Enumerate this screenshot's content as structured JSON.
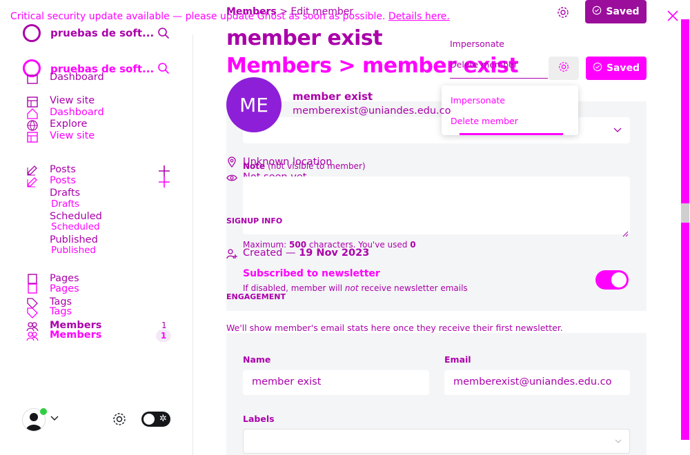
{
  "banner": {
    "text": "Critical security update available — please update Ghost as soon as possible.",
    "link": "Details here."
  },
  "sidebar": {
    "site_name": "pruebas de soft...",
    "site_name_2": "pruebas de soft...",
    "nav_a": [
      "Dashboard",
      "View site"
    ],
    "nav_b": [
      "Dashboard",
      "Explore",
      "View site"
    ],
    "posts": "Posts",
    "posts_2": "Posts",
    "drafts": "Drafts",
    "drafts_2": "Drafts",
    "scheduled": "Scheduled",
    "scheduled_2": "Scheduled",
    "published": "Published",
    "published_2": "Published",
    "pages": "Pages",
    "pages_2": "Pages",
    "tags": "Tags",
    "tags_2": "Tags",
    "members": "Members",
    "members_2": "Members",
    "members_count": "1",
    "members_count_2": "1"
  },
  "header": {
    "breadcrumb_parent": "Members",
    "breadcrumb_sep": ">",
    "breadcrumb_current": "Edit member",
    "title": "member exist",
    "title_2": "Members > member exist",
    "saved": "Saved",
    "saved_2": "Saved"
  },
  "actions_menu": {
    "impersonate": "Impersonate",
    "delete": "Delete member",
    "impersonate_2": "Impersonate",
    "delete_2": "Delete member"
  },
  "member": {
    "initials": "ME",
    "name": "member exist",
    "email": "memberexist@uniandes.edu.co",
    "location": "Unknown location",
    "last_seen": "Not seen yet"
  },
  "signup": {
    "section": "SIGNUP INFO",
    "created_prefix": "Created —",
    "created_date": "19 Nov 2023"
  },
  "engagement": {
    "section": "ENGAGEMENT",
    "info": "We'll show member's email stats here once they receive their first newsletter."
  },
  "note": {
    "label": "Note",
    "hint": "(not visible to member)",
    "max_prefix": "Maximum:",
    "max_value": "500",
    "max_mid": "characters. You've used",
    "used": "0"
  },
  "newsletter": {
    "title": "Subscribed to newsletter",
    "desc_a": "If disabled, member will",
    "desc_em": "not",
    "desc_b": "receive newsletter emails"
  },
  "form": {
    "name_label": "Name",
    "name_value": "member exist",
    "email_label": "Email",
    "email_value": "memberexist@uniandes.edu.co",
    "labels_label": "Labels"
  },
  "colors": {
    "accent": "#ff00ff",
    "purple": "#aa00aa",
    "saved_dark": "#9b0e9b"
  },
  "icons": [
    "close-icon",
    "search-icon",
    "home-icon",
    "external-link-icon",
    "compass-icon",
    "pencil-icon",
    "plus-icon",
    "pages-icon",
    "tag-icon",
    "members-icon",
    "gear-icon",
    "check-circle-icon",
    "location-icon",
    "eye-icon",
    "user-add-icon",
    "chevron-down-icon",
    "moon-toggle-icon"
  ]
}
